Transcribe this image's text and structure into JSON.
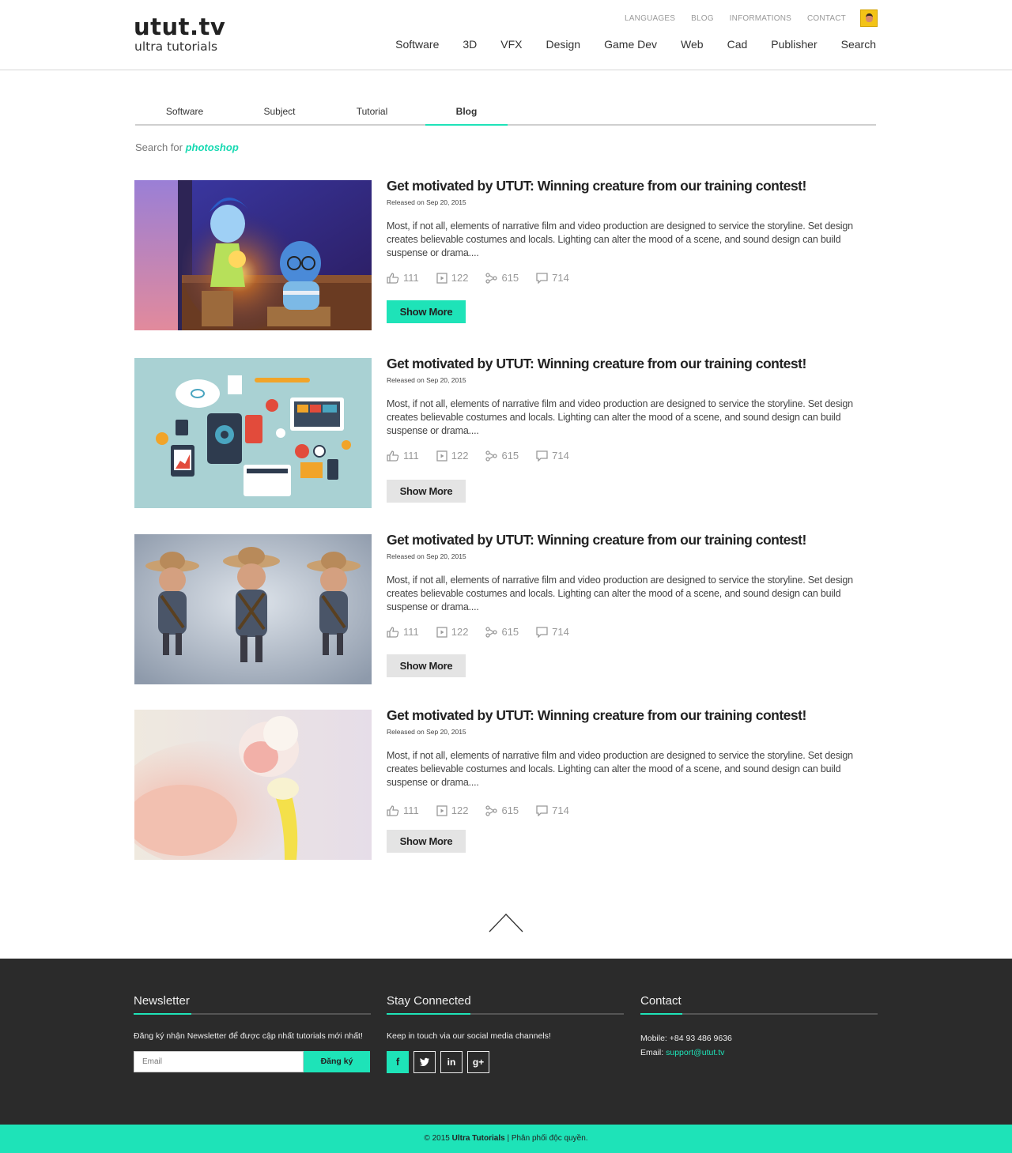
{
  "brand": {
    "name": "utut.tv",
    "tagline": "ultra tutorials"
  },
  "top_links": [
    "LANGUAGES",
    "BLOG",
    "INFORMATIONS",
    "CONTACT"
  ],
  "main_nav": [
    "Software",
    "3D",
    "VFX",
    "Design",
    "Game Dev",
    "Web",
    "Cad",
    "Publisher",
    "Search"
  ],
  "tabs": [
    "Software",
    "Subject",
    "Tutorial",
    "Blog"
  ],
  "active_tab": "Blog",
  "search": {
    "prefix": "Search for",
    "term": "photoshop"
  },
  "posts": [
    {
      "title": "Get motivated by UTUT: Winning creature from our training contest!",
      "date": "Released on Sep 20, 2015",
      "desc": "Most, if not all, elements of narrative film and video production are designed to service the storyline. Set design creates believable costumes and locals. Lighting can alter the mood of a scene, and sound design can build suspense or drama....",
      "likes": "111",
      "videos": "122",
      "shares": "615",
      "comments": "714",
      "button": "Show More",
      "button_active": true
    },
    {
      "title": "Get motivated by UTUT: Winning creature from our training contest!",
      "date": "Released on Sep 20, 2015",
      "desc": "Most, if not all, elements of narrative film and video production are designed to service the storyline. Set design creates believable costumes and locals. Lighting can alter the mood of a scene, and sound design can build suspense or drama....",
      "likes": "111",
      "videos": "122",
      "shares": "615",
      "comments": "714",
      "button": "Show More",
      "button_active": false
    },
    {
      "title": "Get motivated by UTUT: Winning creature from our training contest!",
      "date": "Released on Sep 20, 2015",
      "desc": "Most, if not all, elements of narrative film and video production are designed to service the storyline. Set design creates believable costumes and locals. Lighting can alter the mood of a scene, and sound design can build suspense or drama....",
      "likes": "111",
      "videos": "122",
      "shares": "615",
      "comments": "714",
      "button": "Show More",
      "button_active": false
    },
    {
      "title": "Get motivated by UTUT: Winning creature from our training contest!",
      "date": "Released on Sep 20, 2015",
      "desc": "Most, if not all, elements of narrative film and video production are designed to service the storyline. Set design creates believable costumes and locals. Lighting can alter the mood of a scene, and sound design can build suspense or drama....",
      "likes": "111",
      "videos": "122",
      "shares": "615",
      "comments": "714",
      "button": "Show More",
      "button_active": false
    }
  ],
  "footer": {
    "newsletter": {
      "heading": "Newsletter",
      "text": "Đăng ký nhận Newsletter để được cập nhất tutorials mới nhất!",
      "placeholder": "Email",
      "button": "Đăng ký"
    },
    "social": {
      "heading": "Stay Connected",
      "text": "Keep in touch via our social media channels!",
      "icons": [
        "facebook-icon",
        "twitter-icon",
        "linkedin-icon",
        "google-plus-icon"
      ]
    },
    "contact": {
      "heading": "Contact",
      "mobile_label": "Mobile:",
      "mobile": "+84 93 486 9636",
      "email_label": "Email:",
      "email": "support@utut.tv"
    },
    "copyright_prefix": "© 2015",
    "copyright_brand": "Ultra Tutorials",
    "copyright_suffix": "|  Phân phối độc quyền."
  },
  "colors": {
    "accent": "#1ee3b8",
    "footer_bg": "#2b2b2b",
    "button_idle": "#e4e4e4"
  }
}
